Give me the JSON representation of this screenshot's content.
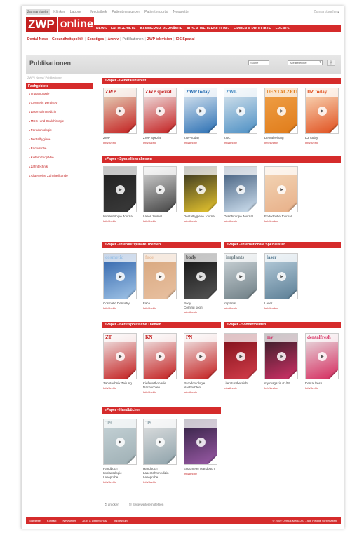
{
  "topbar": {
    "links": [
      "Zahnarztseite",
      "Kliniker",
      "Labore",
      "Mediathek",
      "Patientenratgeber",
      "Patientenportal",
      "Newsletter"
    ],
    "right": "Zahnarztsuche"
  },
  "logo": {
    "zwp": "ZWP",
    "online": "online"
  },
  "mainnav": [
    "NEWS",
    "FACHGEBIETE",
    "KAMMERN & VERBÄNDE",
    "AUS- & WEITERBILDUNG",
    "FIRMEN & PRODUKTE",
    "EVENTS"
  ],
  "subnav": [
    "Dental News",
    "Gesundheitspolitik",
    "Sonstiges",
    "Archiv",
    "Publikationen",
    "ZWP television",
    "IDS Spezial"
  ],
  "page": {
    "title": "Publikationen",
    "search_placeholder": "Suche",
    "select": "Alle Bereiche",
    "breadcrumb": "ZWP / News / Publikationen"
  },
  "sidebar": {
    "header": "Fachgebiete",
    "items": [
      "Implantologie",
      "Cosmetic Dentistry",
      "Laserzahnmedizin",
      "MKG- und Oralchirurgie",
      "Parodontologie",
      "Dentalhygiene",
      "Endodontie",
      "Kieferorthopädie",
      "Zahntechnik",
      "Allgemeine Zahnheilkunde"
    ]
  },
  "sections": {
    "general": "ePaper - General Interest",
    "spezial": "ePaper - Spezialistenthemen",
    "interdis": "ePaper - Interdisziplinäre Themen",
    "intl": "ePaper - Internationale Spezialisten",
    "beruf": "ePaper - Berufspolitische Themen",
    "sonder": "ePaper - Sonderthemen",
    "hand": "ePaper - Handbücher"
  },
  "info": "Info/Archiv",
  "magazines": {
    "general": [
      {
        "name": "ZWP",
        "cover": "ZWP"
      },
      {
        "name": "ZWP Spezial",
        "cover": "ZWP spezial"
      },
      {
        "name": "ZWP today",
        "cover": "ZWP today"
      },
      {
        "name": "ZWL",
        "cover": "ZWL"
      },
      {
        "name": "Dentalzeitung",
        "cover": "DENTALZEITUNG"
      },
      {
        "name": "DZ today",
        "cover": "DZ today"
      }
    ],
    "spezial": [
      {
        "name": "Implantologie Journal",
        "cover": ""
      },
      {
        "name": "Laser Journal",
        "cover": ""
      },
      {
        "name": "Dentalhygiene Journal",
        "cover": ""
      },
      {
        "name": "Oralchirurgie Journal",
        "cover": ""
      },
      {
        "name": "Endodontie Journal",
        "cover": ""
      }
    ],
    "interdis": [
      {
        "name": "Cosmetic Dentistry",
        "cover": "cosmetic"
      },
      {
        "name": "Face",
        "cover": "face"
      },
      {
        "name": "Body\nComing soon!",
        "cover": "body"
      }
    ],
    "intl": [
      {
        "name": "Implants",
        "cover": "implants"
      },
      {
        "name": "Laser",
        "cover": "laser"
      }
    ],
    "beruf": [
      {
        "name": "Zahntechnik Zeitung",
        "cover": "ZT"
      },
      {
        "name": "Kieferorthopädie Nachrichten",
        "cover": "KN"
      },
      {
        "name": "Parodontologie Nachrichten",
        "cover": "PN"
      }
    ],
    "sonder": [
      {
        "name": "Literaturübersicht",
        "cover": ""
      },
      {
        "name": "my magazin 01/09",
        "cover": "my"
      },
      {
        "name": "Dental fresh",
        "cover": "dentalfresh"
      }
    ],
    "hand": [
      {
        "name": "Handbuch Implantologie Leseprobe",
        "cover": "'09"
      },
      {
        "name": "Handbuch Laserzahnmedizin Leseprobe",
        "cover": "'09"
      },
      {
        "name": "Endometer Handbuch",
        "cover": ""
      }
    ]
  },
  "printbar": {
    "print": "drucken",
    "recommend": "Seite weiterempfehlen"
  },
  "footer": {
    "links": [
      "Startseite",
      "Kontakt",
      "Newsletter",
      "AGB & Datenschutz",
      "Impressum"
    ],
    "copyright": "© 2009 Oemus Media AG - Alle Rechte vorbehalten"
  },
  "colors": {
    "brand": "#d52b2b",
    "brand_dark": "#c31f1f"
  }
}
